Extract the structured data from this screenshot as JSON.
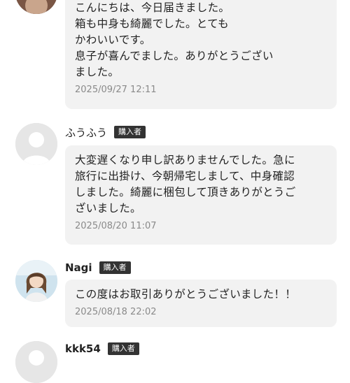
{
  "comments": [
    {
      "username": "",
      "badge": "",
      "text": "こんにちは、今日届きました。\n箱も中身も綺麗でした。とても\nかわいいです。\n息子が喜んでました。ありがとうござい\nました。",
      "timestamp": "2025/09/27 12:11"
    },
    {
      "username": "ふうふう",
      "badge": "購入者",
      "text": "大変遅くなり申し訳ありませんでした。急に\n旅行に出掛け、今朝帰宅しまして、中身確認\nしました。綺麗に梱包して頂きありがとうご\nざいました。",
      "timestamp": "2025/08/20 11:07"
    },
    {
      "username": "Nagi",
      "badge": "購入者",
      "text": "この度はお取引ありがとうございました！！",
      "timestamp": "2025/08/18 22:02"
    },
    {
      "username": "kkk54",
      "badge": "購入者"
    }
  ],
  "colors": {
    "bubble_bg": "#f2f2f2",
    "badge_bg": "#333333",
    "timestamp": "#8a8a8a"
  }
}
